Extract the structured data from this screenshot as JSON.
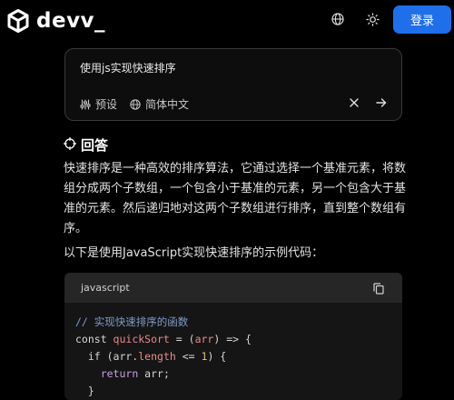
{
  "header": {
    "brand": "devv_",
    "login_label": "登录",
    "icons": [
      "cube-logo-icon",
      "globe-icon",
      "sun-icon"
    ]
  },
  "search": {
    "query": "使用js实现快速排序",
    "preset_label": "预设",
    "language_label": "简体中文",
    "icons": [
      "sliders-icon",
      "globe-icon",
      "close-icon",
      "arrow-right-icon"
    ]
  },
  "answer": {
    "heading": "回答",
    "intro_lines": [
      "快速排序是一种高效的排序算法，它通过选择一个基准元素，将数",
      "组分成两个子数组，一个包含小于基准的元素，另一个包含大于基",
      "准的元素。然后递归地对这两个子数组进行排序，直到整个数组有",
      "序。"
    ],
    "example_intro": "以下是使用JavaScript实现快速排序的示例代码："
  },
  "code": {
    "language": "javascript",
    "lines": [
      "// 实现快速排序的函数",
      "const quickSort = (arr) => {",
      "  if (arr.length <= 1) {",
      "    return arr;",
      "  }"
    ]
  },
  "colors": {
    "background": "#000000",
    "accent": "#1f6feb",
    "code_header": "#262626",
    "code_body": "#151515"
  }
}
